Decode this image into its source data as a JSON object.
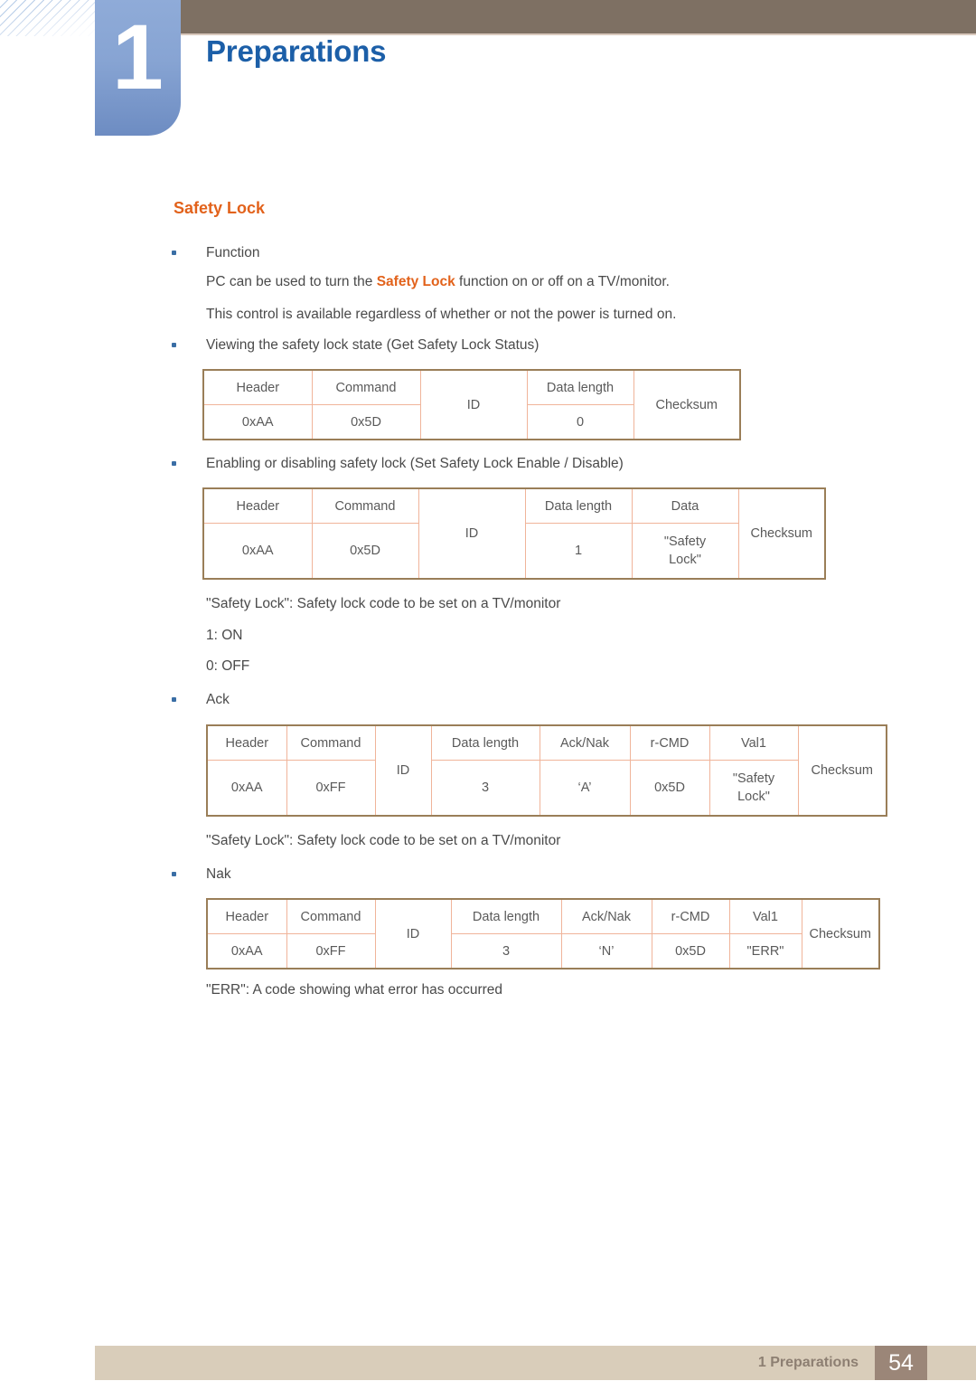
{
  "header": {
    "chapter_number": "1",
    "chapter_title": "Preparations"
  },
  "section": {
    "title": "Safety Lock"
  },
  "body": {
    "function_bullet": "Function",
    "function_line1_pre": "PC can be used to turn the ",
    "function_line1_hl": "Safety Lock",
    "function_line1_post": " function on or off on a TV/monitor.",
    "function_line2": "This control is available regardless of whether or not the power is turned on.",
    "view_bullet": "Viewing the safety lock state (Get Safety Lock Status)",
    "enable_bullet": "Enabling or disabling safety lock (Set Safety Lock Enable / Disable)",
    "safety_lock_note_1": "\"Safety Lock\": Safety lock code to be set on a TV/monitor",
    "on_note": "1: ON",
    "off_note": "0: OFF",
    "ack_bullet": "Ack",
    "safety_lock_note_2": "\"Safety Lock\": Safety lock code to be set on a TV/monitor",
    "nak_bullet": "Nak",
    "err_note": "\"ERR\": A code showing what error has occurred"
  },
  "tables": {
    "get_status": {
      "headers": [
        "Header",
        "Command",
        "ID",
        "Data length",
        "Checksum"
      ],
      "values": [
        "0xAA",
        "0x5D",
        "",
        "0",
        ""
      ]
    },
    "set_enable": {
      "headers": [
        "Header",
        "Command",
        "ID",
        "Data length",
        "Data",
        "Checksum"
      ],
      "values": [
        "0xAA",
        "0x5D",
        "",
        "1",
        "\"Safety Lock\"",
        ""
      ]
    },
    "ack": {
      "headers": [
        "Header",
        "Command",
        "ID",
        "Data length",
        "Ack/Nak",
        "r-CMD",
        "Val1",
        "Checksum"
      ],
      "values": [
        "0xAA",
        "0xFF",
        "",
        "3",
        "‘A’",
        "0x5D",
        "\"Safety Lock\"",
        ""
      ]
    },
    "nak": {
      "headers": [
        "Header",
        "Command",
        "ID",
        "Data length",
        "Ack/Nak",
        "r-CMD",
        "Val1",
        "Checksum"
      ],
      "values": [
        "0xAA",
        "0xFF",
        "",
        "3",
        "‘N’",
        "0x5D",
        "\"ERR\"",
        ""
      ]
    }
  },
  "footer": {
    "label": "1 Preparations",
    "page": "54"
  },
  "colors": {
    "accent_orange": "#e2621b",
    "title_blue": "#1c5fa8",
    "header_brown": "#7e7063",
    "badge_blue": "#87a4d3",
    "table_outer_border": "#9a7e58",
    "table_inner_border": "#f0b49a",
    "footer_bar": "#d9cdba",
    "footer_page_box": "#9b8678"
  }
}
